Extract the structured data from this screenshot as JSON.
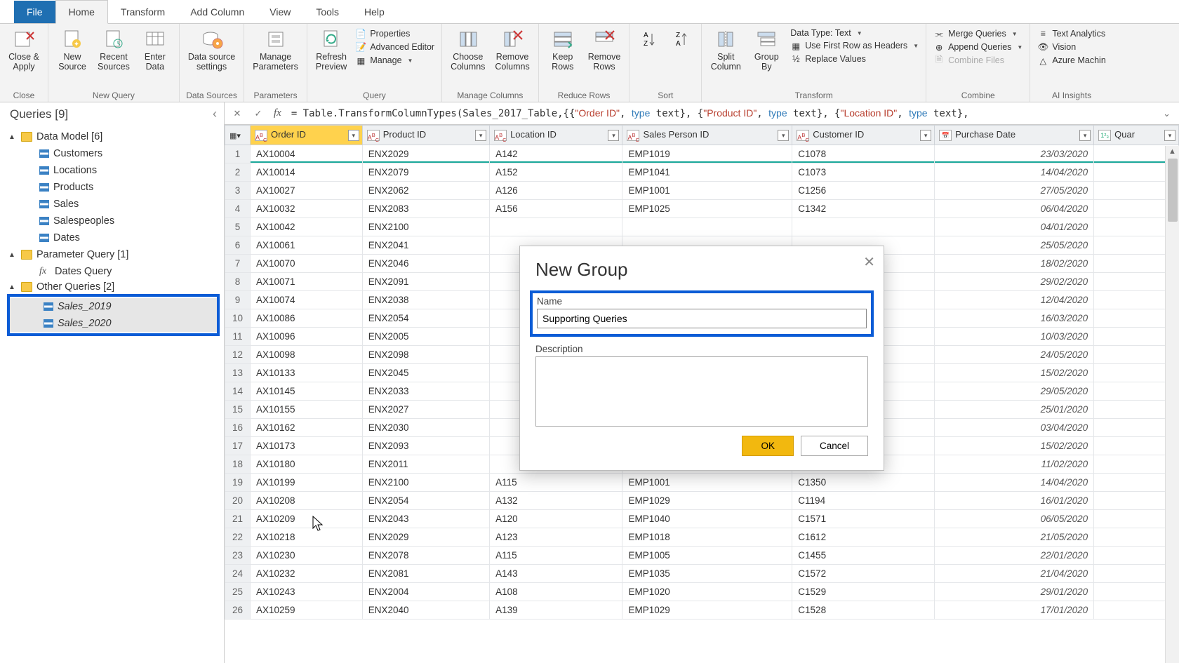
{
  "tabs": {
    "file": "File",
    "home": "Home",
    "transform": "Transform",
    "addcolumn": "Add Column",
    "view": "View",
    "tools": "Tools",
    "help": "Help"
  },
  "ribbon": {
    "close": {
      "closeapply": "Close &\nApply",
      "grp": "Close"
    },
    "newquery": {
      "newsource": "New\nSource",
      "recent": "Recent\nSources",
      "enter": "Enter\nData",
      "grp": "New Query"
    },
    "datasources": {
      "settings": "Data source\nsettings",
      "grp": "Data Sources"
    },
    "parameters": {
      "manage": "Manage\nParameters",
      "grp": "Parameters"
    },
    "query": {
      "refresh": "Refresh\nPreview",
      "properties": "Properties",
      "advanced": "Advanced Editor",
      "managebtn": "Manage",
      "grp": "Query"
    },
    "managecols": {
      "choose": "Choose\nColumns",
      "remove": "Remove\nColumns",
      "grp": "Manage Columns"
    },
    "reducerows": {
      "keep": "Keep\nRows",
      "removerows": "Remove\nRows",
      "grp": "Reduce Rows"
    },
    "sort": {
      "grp": "Sort"
    },
    "transform": {
      "split": "Split\nColumn",
      "groupby": "Group\nBy",
      "datatype": "Data Type: Text",
      "firstrow": "Use First Row as Headers",
      "replace": "Replace Values",
      "grp": "Transform"
    },
    "combine": {
      "merge": "Merge Queries",
      "append": "Append Queries",
      "combinefiles": "Combine Files",
      "grp": "Combine"
    },
    "ai": {
      "text": "Text Analytics",
      "vision": "Vision",
      "azure": "Azure Machin",
      "grp": "AI Insights"
    }
  },
  "queries": {
    "header": "Queries [9]",
    "groups": [
      {
        "name": "Data Model [6]",
        "items": [
          "Customers",
          "Locations",
          "Products",
          "Sales",
          "Salespeoples",
          "Dates"
        ]
      },
      {
        "name": "Parameter Query [1]",
        "fxitems": [
          "Dates Query"
        ]
      },
      {
        "name": "Other Queries [2]",
        "selitems": [
          "Sales_2019",
          "Sales_2020"
        ]
      }
    ]
  },
  "formula": "= Table.TransformColumnTypes(Sales_2017_Table,{{\"Order ID\", type text}, {\"Product ID\", type text}, {\"Location ID\", type text},",
  "columns": [
    "Order ID",
    "Product ID",
    "Location ID",
    "Sales Person ID",
    "Customer ID",
    "Purchase Date",
    "Quar"
  ],
  "rows": [
    {
      "n": 1,
      "order": "AX10004",
      "prod": "ENX2029",
      "loc": "A142",
      "sp": "EMP1019",
      "cust": "C1078",
      "date": "23/03/2020"
    },
    {
      "n": 2,
      "order": "AX10014",
      "prod": "ENX2079",
      "loc": "A152",
      "sp": "EMP1041",
      "cust": "C1073",
      "date": "14/04/2020"
    },
    {
      "n": 3,
      "order": "AX10027",
      "prod": "ENX2062",
      "loc": "A126",
      "sp": "EMP1001",
      "cust": "C1256",
      "date": "27/05/2020"
    },
    {
      "n": 4,
      "order": "AX10032",
      "prod": "ENX2083",
      "loc": "A156",
      "sp": "EMP1025",
      "cust": "C1342",
      "date": "06/04/2020"
    },
    {
      "n": 5,
      "order": "AX10042",
      "prod": "ENX2100",
      "loc": "",
      "sp": "",
      "cust": "",
      "date": "04/01/2020"
    },
    {
      "n": 6,
      "order": "AX10061",
      "prod": "ENX2041",
      "loc": "",
      "sp": "",
      "cust": "",
      "date": "25/05/2020"
    },
    {
      "n": 7,
      "order": "AX10070",
      "prod": "ENX2046",
      "loc": "",
      "sp": "",
      "cust": "",
      "date": "18/02/2020"
    },
    {
      "n": 8,
      "order": "AX10071",
      "prod": "ENX2091",
      "loc": "",
      "sp": "",
      "cust": "",
      "date": "29/02/2020"
    },
    {
      "n": 9,
      "order": "AX10074",
      "prod": "ENX2038",
      "loc": "",
      "sp": "",
      "cust": "",
      "date": "12/04/2020"
    },
    {
      "n": 10,
      "order": "AX10086",
      "prod": "ENX2054",
      "loc": "",
      "sp": "",
      "cust": "",
      "date": "16/03/2020"
    },
    {
      "n": 11,
      "order": "AX10096",
      "prod": "ENX2005",
      "loc": "",
      "sp": "",
      "cust": "",
      "date": "10/03/2020"
    },
    {
      "n": 12,
      "order": "AX10098",
      "prod": "ENX2098",
      "loc": "",
      "sp": "",
      "cust": "",
      "date": "24/05/2020"
    },
    {
      "n": 13,
      "order": "AX10133",
      "prod": "ENX2045",
      "loc": "",
      "sp": "",
      "cust": "",
      "date": "15/02/2020"
    },
    {
      "n": 14,
      "order": "AX10145",
      "prod": "ENX2033",
      "loc": "",
      "sp": "",
      "cust": "",
      "date": "29/05/2020"
    },
    {
      "n": 15,
      "order": "AX10155",
      "prod": "ENX2027",
      "loc": "",
      "sp": "",
      "cust": "",
      "date": "25/01/2020"
    },
    {
      "n": 16,
      "order": "AX10162",
      "prod": "ENX2030",
      "loc": "",
      "sp": "",
      "cust": "",
      "date": "03/04/2020"
    },
    {
      "n": 17,
      "order": "AX10173",
      "prod": "ENX2093",
      "loc": "",
      "sp": "",
      "cust": "",
      "date": "15/02/2020"
    },
    {
      "n": 18,
      "order": "AX10180",
      "prod": "ENX2011",
      "loc": "",
      "sp": "",
      "cust": "",
      "date": "11/02/2020"
    },
    {
      "n": 19,
      "order": "AX10199",
      "prod": "ENX2100",
      "loc": "A115",
      "sp": "EMP1001",
      "cust": "C1350",
      "date": "14/04/2020"
    },
    {
      "n": 20,
      "order": "AX10208",
      "prod": "ENX2054",
      "loc": "A132",
      "sp": "EMP1029",
      "cust": "C1194",
      "date": "16/01/2020"
    },
    {
      "n": 21,
      "order": "AX10209",
      "prod": "ENX2043",
      "loc": "A120",
      "sp": "EMP1040",
      "cust": "C1571",
      "date": "06/05/2020"
    },
    {
      "n": 22,
      "order": "AX10218",
      "prod": "ENX2029",
      "loc": "A123",
      "sp": "EMP1018",
      "cust": "C1612",
      "date": "21/05/2020"
    },
    {
      "n": 23,
      "order": "AX10230",
      "prod": "ENX2078",
      "loc": "A115",
      "sp": "EMP1005",
      "cust": "C1455",
      "date": "22/01/2020"
    },
    {
      "n": 24,
      "order": "AX10232",
      "prod": "ENX2081",
      "loc": "A143",
      "sp": "EMP1035",
      "cust": "C1572",
      "date": "21/04/2020"
    },
    {
      "n": 25,
      "order": "AX10243",
      "prod": "ENX2004",
      "loc": "A108",
      "sp": "EMP1020",
      "cust": "C1529",
      "date": "29/01/2020"
    },
    {
      "n": 26,
      "order": "AX10259",
      "prod": "ENX2040",
      "loc": "A139",
      "sp": "EMP1029",
      "cust": "C1528",
      "date": "17/01/2020"
    }
  ],
  "dialog": {
    "title": "New Group",
    "name_label": "Name",
    "name_value": "Supporting Queries",
    "desc_label": "Description",
    "ok": "OK",
    "cancel": "Cancel"
  }
}
